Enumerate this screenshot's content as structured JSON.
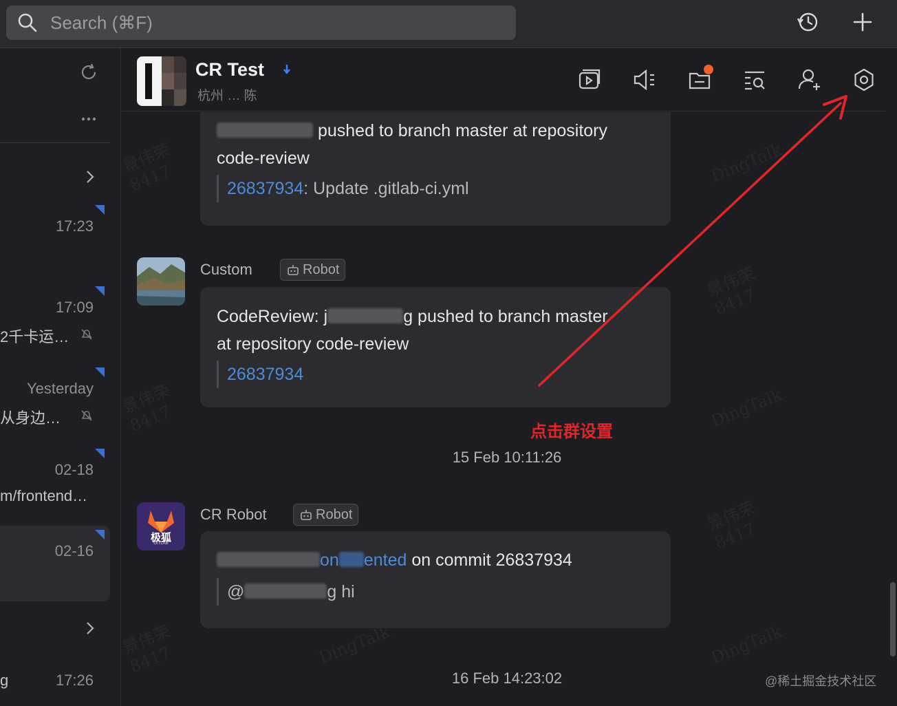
{
  "search": {
    "placeholder": "Search (⌘F)"
  },
  "topbar": {
    "history_icon": "history-icon",
    "add_icon": "plus-icon"
  },
  "sidebar": {
    "conversations": [
      {
        "time": "17:23",
        "snippet": ""
      },
      {
        "time": "17:09",
        "snippet": "2千卡运…",
        "muted": true
      },
      {
        "time": "Yesterday",
        "snippet": "从身边…",
        "muted": true
      },
      {
        "time": "02-18",
        "snippet": "m/frontend…"
      },
      {
        "time": "02-16",
        "snippet": "",
        "active": true
      },
      {
        "time": "17:26",
        "snippet": "g"
      }
    ]
  },
  "header": {
    "title": "CR Test",
    "subtitle": "杭州 … 陈",
    "icons": [
      "video-meeting-icon",
      "announcement-icon",
      "files-icon",
      "search-history-icon",
      "add-member-icon",
      "settings-icon"
    ]
  },
  "messages": {
    "first": {
      "line1_rest": "pushed to branch master at repository",
      "line2": "code-review",
      "commit_link": "26837934",
      "commit_msg": ": Update .gitlab-ci.yml"
    },
    "custom": {
      "sender": "Custom",
      "tag": "Robot",
      "line1_prefix": "CodeReview: j",
      "line1_mid": "g",
      "line1_rest": " pushed to branch master",
      "line2": "at repository code-review",
      "commit_link": "26837934"
    },
    "time1": "15 Feb 10:11:26",
    "cr_robot": {
      "sender": "CR Robot",
      "tag": "Robot",
      "avatar_text": "极狐",
      "avatar_small": "GITLAB",
      "link_part1": "on",
      "link_part2": "ented",
      "line1_rest": " on commit 26837934",
      "quote_prefix": "@",
      "quote_rest": "g hi"
    },
    "time2": "16 Feb 14:23:02"
  },
  "annotation": {
    "text": "点击群设置"
  },
  "credit": "@稀土掘金技术社区",
  "colors": {
    "accent_link": "#4b8cdc",
    "annotation_red": "#e0262a",
    "badge": "#f0622b"
  }
}
